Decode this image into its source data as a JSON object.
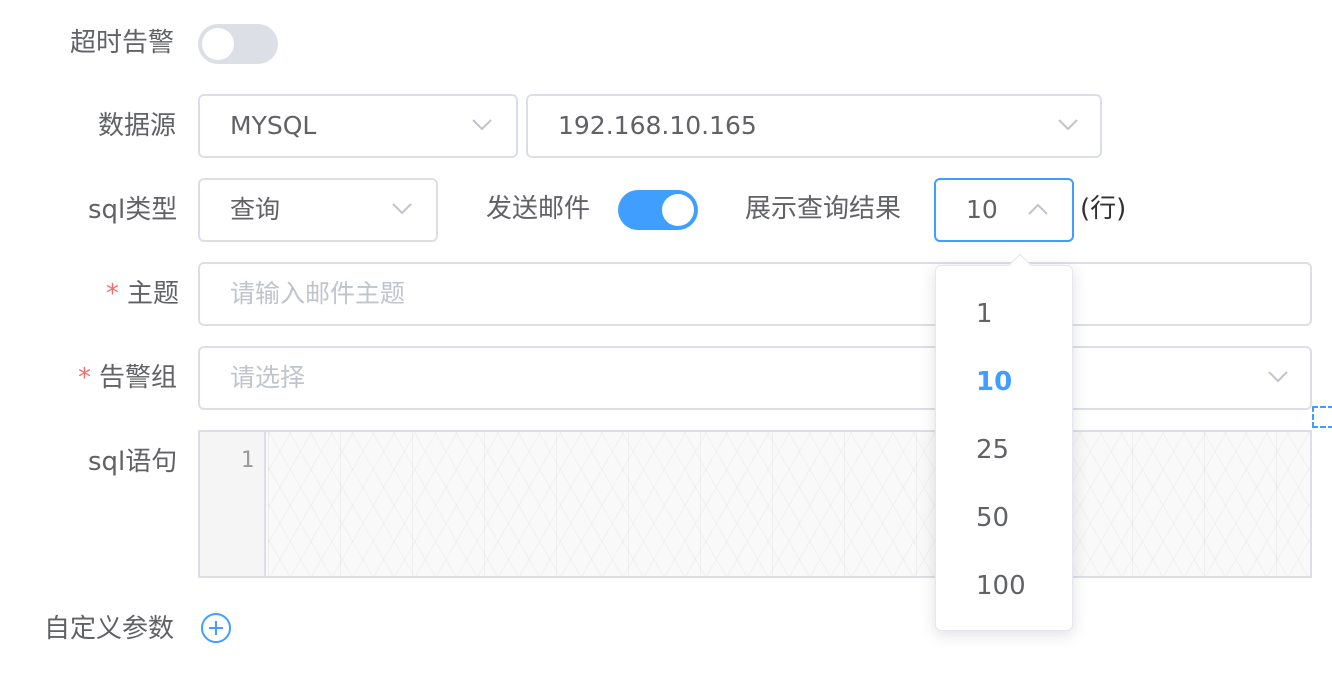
{
  "timeout_alarm": {
    "label": "超时告警",
    "enabled": false
  },
  "datasource": {
    "label": "数据源",
    "type": "MYSQL",
    "host": "192.168.10.165"
  },
  "sql_type": {
    "label": "sql类型",
    "value": "查询"
  },
  "send_mail": {
    "label": "发送邮件",
    "enabled": true
  },
  "show_results": {
    "label": "展示查询结果",
    "value": "10",
    "unit": "(行)",
    "options": [
      "1",
      "10",
      "25",
      "50",
      "100"
    ],
    "selected": "10"
  },
  "subject": {
    "label": "主题",
    "required_mark": "*",
    "placeholder": "请输入邮件主题"
  },
  "alarm_group": {
    "label": "告警组",
    "required_mark": "*",
    "placeholder": "请选择"
  },
  "sql_statement": {
    "label": "sql语句",
    "line_number": "1"
  },
  "custom_params": {
    "label": "自定义参数"
  },
  "colors": {
    "accent": "#409eff",
    "border": "#dcdfe6",
    "text": "#606266",
    "placeholder": "#c0c4cc",
    "required": "#f56c6c"
  }
}
